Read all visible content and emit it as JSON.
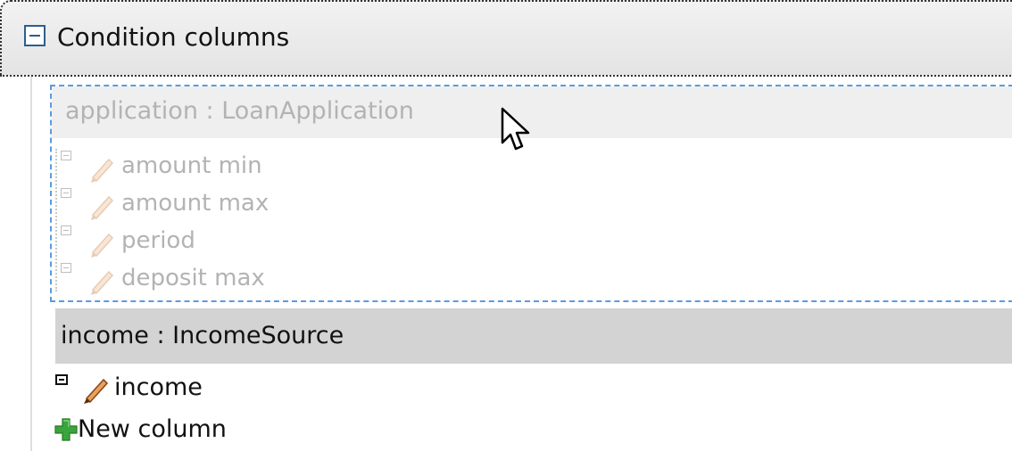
{
  "section": {
    "title": "Condition columns",
    "toggle_icon": "collapse-minus-icon"
  },
  "dragged_pattern": {
    "title": "application : LoanApplication",
    "fields": [
      {
        "label": "amount min",
        "icon": "pencil-icon"
      },
      {
        "label": "amount max",
        "icon": "pencil-icon"
      },
      {
        "label": "period",
        "icon": "pencil-icon"
      },
      {
        "label": "deposit max",
        "icon": "pencil-icon"
      }
    ]
  },
  "pattern": {
    "title": "income : IncomeSource",
    "fields": [
      {
        "label": "income",
        "icon": "pencil-icon"
      }
    ]
  },
  "new_column": {
    "label": "New column",
    "icon": "plus-icon"
  },
  "colors": {
    "header_bg": "#e8e8e8",
    "pattern_header_bg": "#d3d3d3",
    "drag_border": "#5b9be0",
    "ghost_text": "#b3b3b3",
    "plus_green": "#3aa53a"
  },
  "cursor": "arrow-pointer-icon"
}
